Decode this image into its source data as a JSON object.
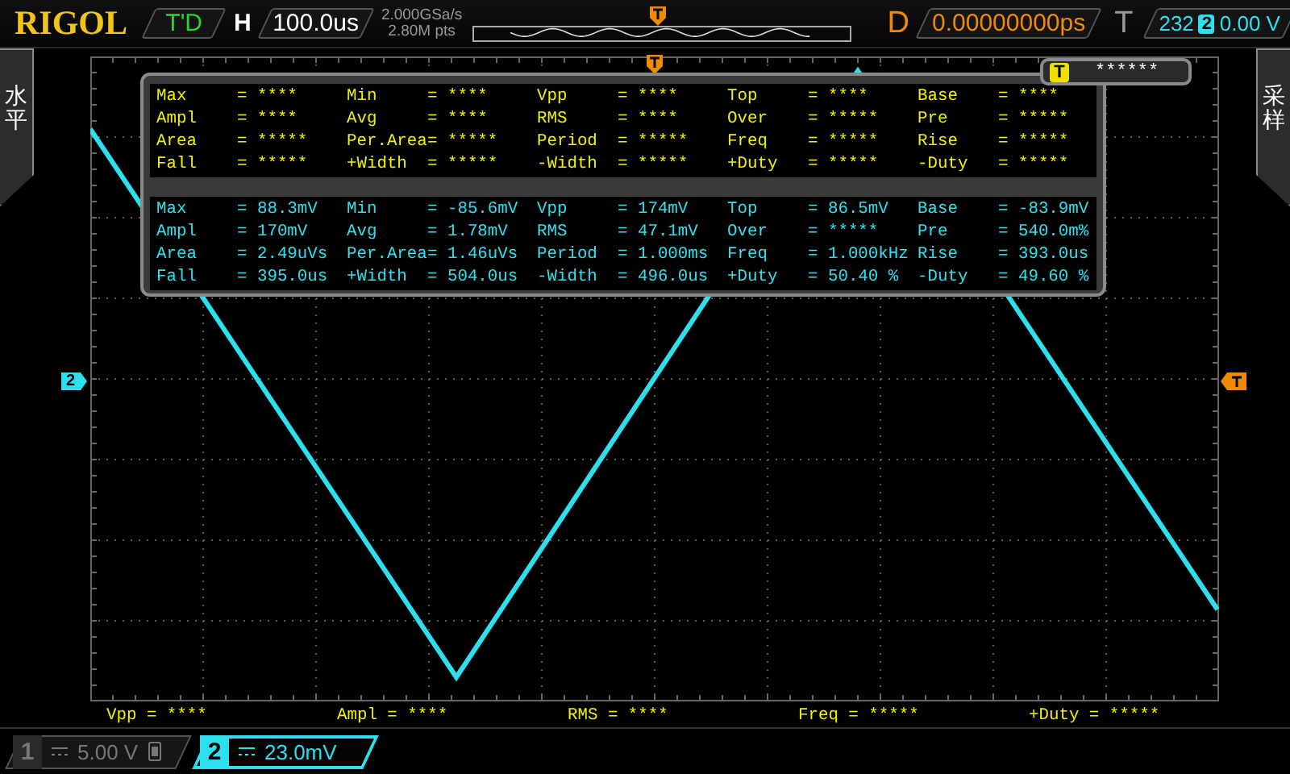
{
  "top_bar": {
    "logo": "RIGOL",
    "trigger_status": "T'D",
    "horizontal_label": "H",
    "timebase": "100.0us",
    "sample_rate": "2.000GSa/s",
    "memory_depth": "2.80M pts",
    "delay_label": "D",
    "delay": "0.00000000ps",
    "trigger_label": "T",
    "trigger_count": "232",
    "trigger_source": "2",
    "trigger_level": "0.00 V"
  },
  "side_tabs": [
    {
      "label": "水平"
    },
    {
      "label": "采样"
    }
  ],
  "channel_marker": "2",
  "measure_panel": {
    "sections": [
      {
        "kind": "ch1",
        "rows": [
          [
            {
              "label": "Max",
              "value": "= ****"
            },
            {
              "label": "Min",
              "value": "= ****"
            },
            {
              "label": "Vpp",
              "value": "= ****"
            },
            {
              "label": "Top",
              "value": "= ****"
            },
            {
              "label": "Base",
              "value": "= ****"
            }
          ],
          [
            {
              "label": "Ampl",
              "value": "= ****"
            },
            {
              "label": "Avg",
              "value": "= ****"
            },
            {
              "label": "RMS",
              "value": "= ****"
            },
            {
              "label": "Over",
              "value": "= *****"
            },
            {
              "label": "Pre",
              "value": "= *****"
            }
          ],
          [
            {
              "label": "Area",
              "value": "= *****"
            },
            {
              "label": "Per.Area",
              "value": "= *****"
            },
            {
              "label": "Period",
              "value": "= *****"
            },
            {
              "label": "Freq",
              "value": "= *****"
            },
            {
              "label": "Rise",
              "value": "= *****"
            }
          ],
          [
            {
              "label": "Fall",
              "value": "= *****"
            },
            {
              "label": "+Width",
              "value": "= *****"
            },
            {
              "label": "-Width",
              "value": "= *****"
            },
            {
              "label": "+Duty",
              "value": "= *****"
            },
            {
              "label": "-Duty",
              "value": "= *****"
            }
          ]
        ]
      },
      {
        "kind": "ch2",
        "rows": [
          [
            {
              "label": "Max",
              "value": "= 88.3mV"
            },
            {
              "label": "Min",
              "value": "= -85.6mV"
            },
            {
              "label": "Vpp",
              "value": "= 174mV"
            },
            {
              "label": "Top",
              "value": "= 86.5mV"
            },
            {
              "label": "Base",
              "value": "= -83.9mV"
            }
          ],
          [
            {
              "label": "Ampl",
              "value": "= 170mV"
            },
            {
              "label": "Avg",
              "value": "= 1.78mV"
            },
            {
              "label": "RMS",
              "value": "= 47.1mV"
            },
            {
              "label": "Over",
              "value": "= *****"
            },
            {
              "label": "Pre",
              "value": "= 540.0m%"
            }
          ],
          [
            {
              "label": "Area",
              "value": "= 2.49uVs"
            },
            {
              "label": "Per.Area",
              "value": "= 1.46uVs"
            },
            {
              "label": "Period",
              "value": "= 1.000ms"
            },
            {
              "label": "Freq",
              "value": "= 1.000kHz"
            },
            {
              "label": "Rise",
              "value": "= 393.0us"
            }
          ],
          [
            {
              "label": "Fall",
              "value": "= 395.0us"
            },
            {
              "label": "+Width",
              "value": "= 504.0us"
            },
            {
              "label": "-Width",
              "value": "= 496.0us"
            },
            {
              "label": "+Duty",
              "value": "= 50.40 %"
            },
            {
              "label": "-Duty",
              "value": "= 49.60 %"
            }
          ]
        ]
      }
    ]
  },
  "trigger_popup": {
    "badge": "T",
    "value": "******"
  },
  "bottom_measurements": [
    "Vpp = ****",
    "Ampl = ****",
    "RMS = ****",
    "Freq = *****",
    "+Duty = *****"
  ],
  "channels": [
    {
      "number": "1",
      "scale": "5.00 V",
      "active": false
    },
    {
      "number": "2",
      "scale": "23.0mV",
      "active": true
    }
  ]
}
